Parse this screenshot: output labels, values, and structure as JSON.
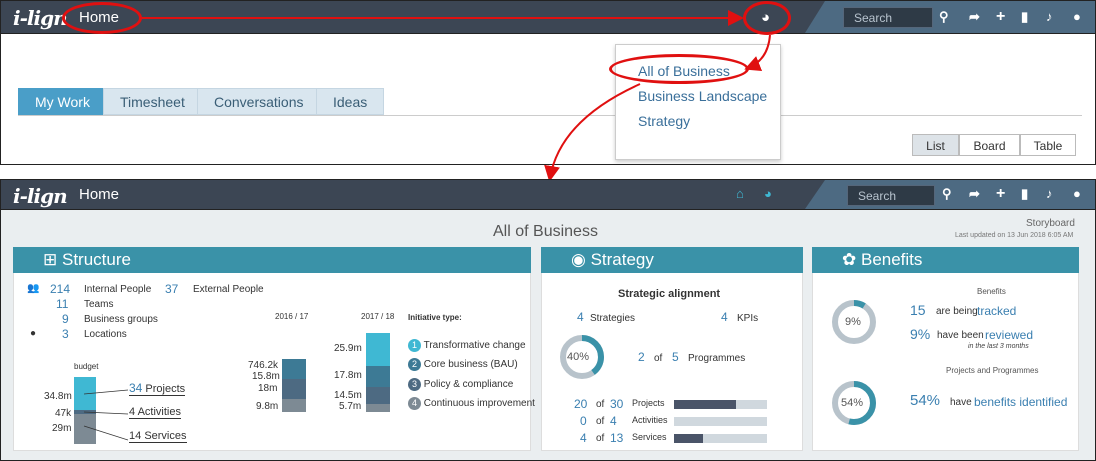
{
  "top_nav": {
    "logo": "i-lign",
    "home": "Home",
    "search_placeholder": "Search"
  },
  "tabs": [
    {
      "label": "My Work"
    },
    {
      "label": "Timesheet"
    },
    {
      "label": "Conversations"
    },
    {
      "label": "Ideas"
    }
  ],
  "view_buttons": {
    "list": "List",
    "board": "Board",
    "table": "Table"
  },
  "dropdown": {
    "items": [
      "All of Business",
      "Business Landscape",
      "Strategy"
    ]
  },
  "bottom_nav": {
    "logo": "i-lign",
    "home": "Home",
    "search_placeholder": "Search"
  },
  "page": {
    "title": "All of Business",
    "storyboard": "Storyboard",
    "updated": "Last updated on 13 Jun 2018 6:05 AM"
  },
  "structure": {
    "title": "Structure",
    "internal_people": "214",
    "internal_people_label": "Internal People",
    "external_people": "37",
    "external_people_label": "External People",
    "teams": "11",
    "teams_label": "Teams",
    "business_groups": "9",
    "business_groups_label": "Business groups",
    "locations": "3",
    "locations_label": "Locations",
    "budget_label": "budget",
    "budget_vals": [
      "34.8m",
      "47k",
      "29m"
    ],
    "projects": "34",
    "projects_label": "Projects",
    "activities": "4",
    "activities_label": "Activities",
    "services": "14",
    "services_label": "Services",
    "col2016": "2016 / 17",
    "col2017": "2017 / 18",
    "vals2016": [
      "746.2k",
      "15.8m",
      "18m",
      "9.8m"
    ],
    "vals2017": [
      "25.9m",
      "17.8m",
      "14.5m",
      "5.7m"
    ],
    "initiative_title": "Initiative type:",
    "initiatives": [
      "Transformative change",
      "Core business (BAU)",
      "Policy & compliance",
      "Continuous improvement"
    ]
  },
  "strategy": {
    "title": "Strategy",
    "subtitle": "Strategic alignment",
    "strategies": "4",
    "strategies_label": "Strategies",
    "kpis": "4",
    "kpis_label": "KPIs",
    "donut": "40%",
    "programmes_a": "2",
    "of": "of",
    "programmes_b": "5",
    "programmes_label": "Programmes",
    "rows": [
      {
        "a": "20",
        "b": "30",
        "label": "Projects",
        "fill": 0.67
      },
      {
        "a": "0",
        "b": "4",
        "label": "Activities",
        "fill": 0
      },
      {
        "a": "4",
        "b": "13",
        "label": "Services",
        "fill": 0.31
      }
    ]
  },
  "benefits": {
    "title": "Benefits",
    "section1": "Benefits",
    "donut1": "9%",
    "tracked_num": "15",
    "tracked_pre": "are being",
    "tracked_link": "tracked",
    "reviewed_num": "9%",
    "reviewed_pre": "have been",
    "reviewed_link": "reviewed",
    "last3": "in the last 3 months",
    "section2": "Projects and Programmes",
    "donut2": "54%",
    "ident_num": "54%",
    "ident_pre": "have",
    "ident_link": "benefits identified"
  },
  "colors": {
    "teal": "#3a92a8",
    "nav": "#3c4654",
    "accent": "#3fb8d3",
    "annotation": "#e01010"
  }
}
